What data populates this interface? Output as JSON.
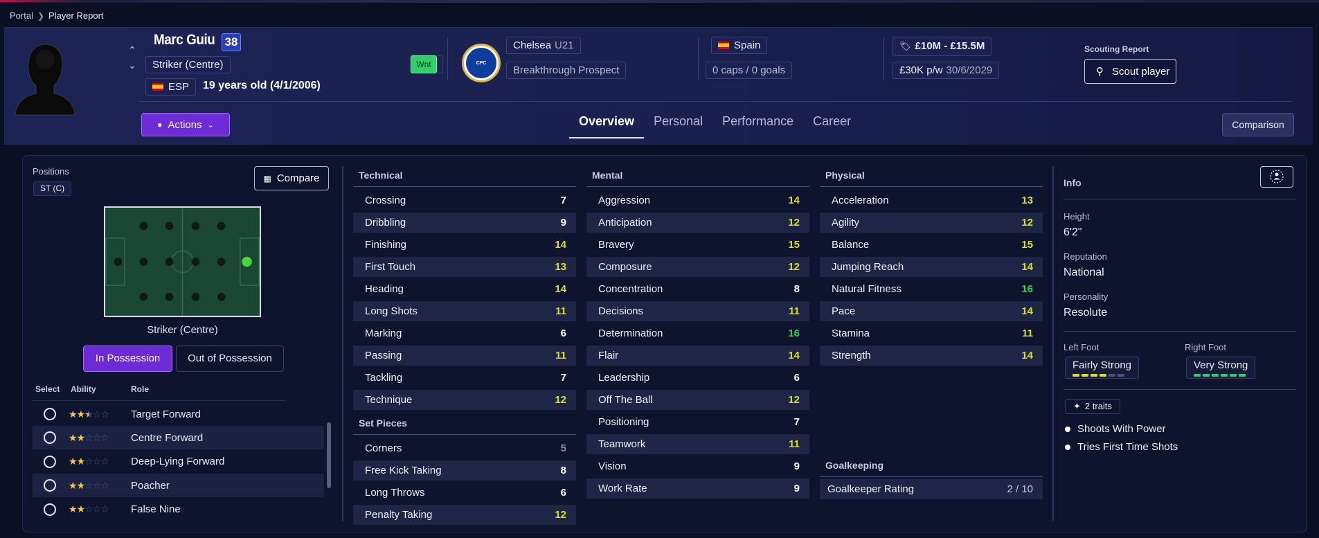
{
  "breadcrumb": {
    "root": "Portal",
    "current": "Player Report"
  },
  "player": {
    "name": "Marc Guiu",
    "rating": "38",
    "position": "Striker (Centre)",
    "nation_code": "ESP",
    "age_text": "19 years old (4/1/2006)",
    "tag": "Wnt"
  },
  "club": {
    "name": "Chelsea",
    "squad": "U21",
    "status": "Breakthrough Prospect"
  },
  "nation": {
    "name": "Spain",
    "caps": "0 caps / 0 goals"
  },
  "value": {
    "range": "£10M - £15.5M",
    "wage": "£30K p/w",
    "contract_end": "30/6/2029"
  },
  "scouting": {
    "label": "Scouting Report",
    "button": "Scout player"
  },
  "actions_label": "Actions",
  "tabs": [
    "Overview",
    "Personal",
    "Performance",
    "Career"
  ],
  "comparison_label": "Comparison",
  "positions": {
    "label": "Positions",
    "chip": "ST (C)",
    "compare_label": "Compare",
    "pitch_label": "Striker (Centre)"
  },
  "possession": {
    "in": "In Possession",
    "out": "Out of Possession"
  },
  "roles": {
    "headers": [
      "Select",
      "Ability",
      "Role"
    ],
    "items": [
      {
        "name": "Target Forward",
        "stars": 2.5
      },
      {
        "name": "Centre Forward",
        "stars": 2
      },
      {
        "name": "Deep-Lying Forward",
        "stars": 2
      },
      {
        "name": "Poacher",
        "stars": 2
      },
      {
        "name": "False Nine",
        "stars": 2
      }
    ]
  },
  "technical": {
    "title": "Technical",
    "items": [
      {
        "name": "Crossing",
        "value": "7"
      },
      {
        "name": "Dribbling",
        "value": "9"
      },
      {
        "name": "Finishing",
        "value": "14"
      },
      {
        "name": "First Touch",
        "value": "13"
      },
      {
        "name": "Heading",
        "value": "14"
      },
      {
        "name": "Long Shots",
        "value": "11"
      },
      {
        "name": "Marking",
        "value": "6"
      },
      {
        "name": "Passing",
        "value": "11"
      },
      {
        "name": "Tackling",
        "value": "7"
      },
      {
        "name": "Technique",
        "value": "12"
      }
    ]
  },
  "set_pieces": {
    "title": "Set Pieces",
    "items": [
      {
        "name": "Corners",
        "value": "5"
      },
      {
        "name": "Free Kick Taking",
        "value": "8"
      },
      {
        "name": "Long Throws",
        "value": "6"
      },
      {
        "name": "Penalty Taking",
        "value": "12"
      }
    ]
  },
  "mental": {
    "title": "Mental",
    "items": [
      {
        "name": "Aggression",
        "value": "14"
      },
      {
        "name": "Anticipation",
        "value": "12"
      },
      {
        "name": "Bravery",
        "value": "15"
      },
      {
        "name": "Composure",
        "value": "12"
      },
      {
        "name": "Concentration",
        "value": "8"
      },
      {
        "name": "Decisions",
        "value": "11"
      },
      {
        "name": "Determination",
        "value": "16"
      },
      {
        "name": "Flair",
        "value": "14"
      },
      {
        "name": "Leadership",
        "value": "6"
      },
      {
        "name": "Off The Ball",
        "value": "12"
      },
      {
        "name": "Positioning",
        "value": "7"
      },
      {
        "name": "Teamwork",
        "value": "11"
      },
      {
        "name": "Vision",
        "value": "9"
      },
      {
        "name": "Work Rate",
        "value": "9"
      }
    ]
  },
  "physical": {
    "title": "Physical",
    "items": [
      {
        "name": "Acceleration",
        "value": "13"
      },
      {
        "name": "Agility",
        "value": "12"
      },
      {
        "name": "Balance",
        "value": "15"
      },
      {
        "name": "Jumping Reach",
        "value": "14"
      },
      {
        "name": "Natural Fitness",
        "value": "16"
      },
      {
        "name": "Pace",
        "value": "14"
      },
      {
        "name": "Stamina",
        "value": "11"
      },
      {
        "name": "Strength",
        "value": "14"
      }
    ]
  },
  "goalkeeping": {
    "title": "Goalkeeping",
    "label": "Goalkeeper Rating",
    "value": "2 / 10"
  },
  "info": {
    "title": "Info",
    "height_label": "Height",
    "height": "6'2\"",
    "reputation_label": "Reputation",
    "reputation": "National",
    "personality_label": "Personality",
    "personality": "Resolute",
    "left_foot_label": "Left Foot",
    "left_foot": "Fairly Strong",
    "left_foot_level": 4,
    "right_foot_label": "Right Foot",
    "right_foot": "Very Strong",
    "right_foot_level": 6,
    "traits_label": "2 traits",
    "traits": [
      "Shoots With Power",
      "Tries First Time Shots"
    ]
  },
  "colors": {
    "accent": "#6d2bd6",
    "attr_high": "#30d158",
    "attr_mid": "#d9e021",
    "attr_low": "#ffffff",
    "attr_min": "#8a8fa8"
  }
}
